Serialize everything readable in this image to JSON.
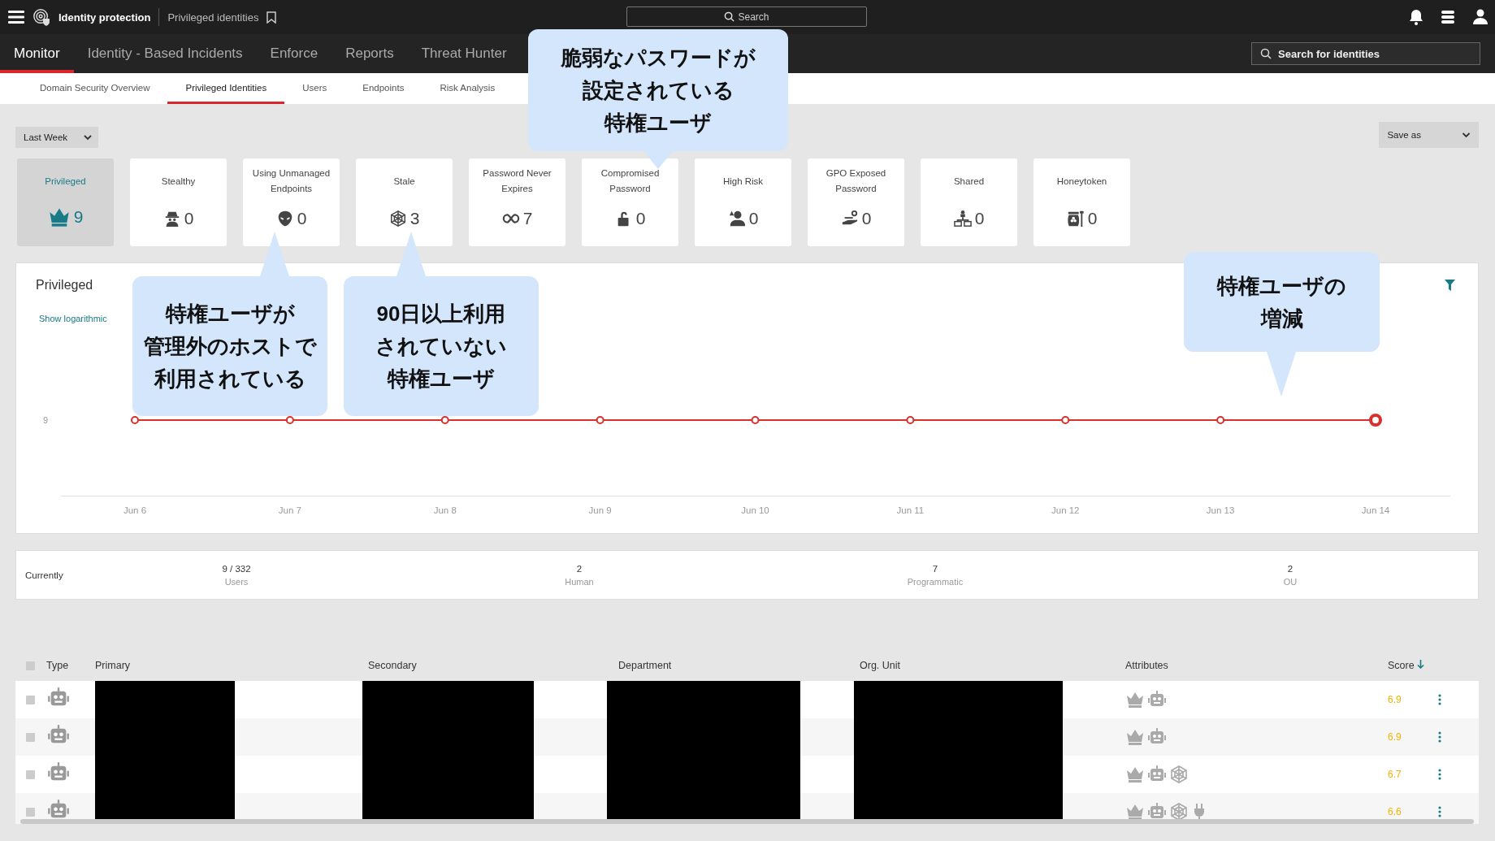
{
  "topbar": {
    "app_name": "Identity protection",
    "page": "Privileged identities",
    "search": {
      "placeholder": "Search"
    }
  },
  "nav_tabs": [
    {
      "label": "Monitor",
      "selected": true
    },
    {
      "label": "Identity - Based Incidents",
      "selected": false
    },
    {
      "label": "Enforce",
      "selected": false
    },
    {
      "label": "Reports",
      "selected": false
    },
    {
      "label": "Threat Hunter",
      "selected": false
    }
  ],
  "identity_search": {
    "placeholder": "Search for identities"
  },
  "sub_tabs": [
    {
      "label": "Domain Security Overview",
      "selected": false
    },
    {
      "label": "Privileged Identities",
      "selected": true
    },
    {
      "label": "Users",
      "selected": false
    },
    {
      "label": "Endpoints",
      "selected": false
    },
    {
      "label": "Risk Analysis",
      "selected": false
    }
  ],
  "period": "Last Week",
  "save_as": "Save as",
  "cards": [
    {
      "label": "Privileged",
      "count": "9",
      "kind": "crown",
      "selected": true
    },
    {
      "label": "Stealthy",
      "count": "0",
      "kind": "spy",
      "selected": false
    },
    {
      "label": "Using Unmanaged Endpoints",
      "count": "0",
      "kind": "alien",
      "selected": false
    },
    {
      "label": "Stale",
      "count": "3",
      "kind": "web",
      "selected": false
    },
    {
      "label": "Password Never Expires",
      "count": "7",
      "kind": "infinity",
      "selected": false
    },
    {
      "label": "Compromised Password",
      "count": "0",
      "kind": "unlock",
      "selected": false
    },
    {
      "label": "High Risk",
      "count": "0",
      "kind": "user-alert",
      "selected": false
    },
    {
      "label": "GPO Exposed Password",
      "count": "0",
      "kind": "hand-key",
      "selected": false
    },
    {
      "label": "Shared",
      "count": "0",
      "kind": "network",
      "selected": false
    },
    {
      "label": "Honeytoken",
      "count": "0",
      "kind": "jar",
      "selected": false
    }
  ],
  "chart_panel": {
    "title": "Privileged",
    "log_link": "Show logarithmic",
    "y_axis_value": "9",
    "x_labels": [
      "Jun 6",
      "Jun 7",
      "Jun 8",
      "Jun 9",
      "Jun 10",
      "Jun 11",
      "Jun 12",
      "Jun 13",
      "Jun 14"
    ]
  },
  "summary": {
    "label": "Currently",
    "stats": [
      {
        "value": "9 / 332",
        "caption": "Users"
      },
      {
        "value": "2",
        "caption": "Human"
      },
      {
        "value": "7",
        "caption": "Programmatic"
      },
      {
        "value": "2",
        "caption": "OU"
      }
    ]
  },
  "table": {
    "select_all_checked": false,
    "columns": [
      "Type",
      "Primary",
      "Secondary",
      "Department",
      "Org. Unit",
      "Attributes",
      "Score"
    ],
    "rows": [
      {
        "type": {
          "kind": "robot"
        },
        "attributes": [
          {
            "kind": "crown"
          },
          {
            "kind": "robot"
          }
        ],
        "score": "6.9",
        "checked": false
      },
      {
        "type": {
          "kind": "robot"
        },
        "attributes": [
          {
            "kind": "crown"
          },
          {
            "kind": "robot"
          }
        ],
        "score": "6.9",
        "checked": false
      },
      {
        "type": {
          "kind": "robot"
        },
        "attributes": [
          {
            "kind": "crown"
          },
          {
            "kind": "robot"
          },
          {
            "kind": "web"
          }
        ],
        "score": "6.7",
        "checked": false
      },
      {
        "type": {
          "kind": "robot"
        },
        "attributes": [
          {
            "kind": "crown"
          },
          {
            "kind": "robot"
          },
          {
            "kind": "web"
          },
          {
            "kind": "plug"
          }
        ],
        "score": "6.6",
        "checked": false
      }
    ]
  },
  "callouts": [
    {
      "lines": [
        "脆弱なパスワードが",
        "設定されている",
        "特権ユーザ"
      ],
      "kind": "pointer-down"
    },
    {
      "lines": [
        "特権ユーザが",
        "管理外のホストで",
        "利用されている"
      ],
      "kind": "pointer-up"
    },
    {
      "lines": [
        "90日以上利用",
        "されていない",
        "特権ユーザ"
      ],
      "kind": "pointer-up"
    },
    {
      "lines": [
        "特権ユーザの",
        "増減"
      ],
      "kind": "pointer-down"
    }
  ]
}
